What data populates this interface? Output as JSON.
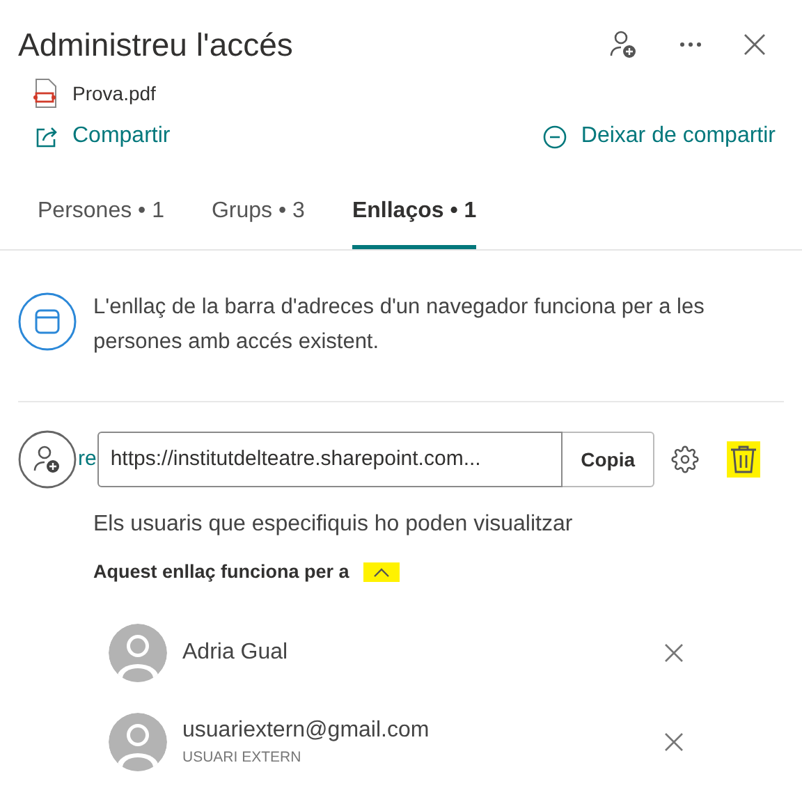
{
  "title": "Administreu l'accés",
  "file": {
    "name": "Prova.pdf"
  },
  "actions": {
    "share": "Compartir",
    "stop_sharing": "Deixar de compartir"
  },
  "tabs": [
    {
      "label": "Persones • 1",
      "selected": false
    },
    {
      "label": "Grups • 3",
      "selected": false
    },
    {
      "label": "Enllaços • 1",
      "selected": true
    }
  ],
  "info": "L'enllaç de la barra d'adreces d'un navegador funciona per a les persones amb accés existent.",
  "link": {
    "hidden_fragment": "re",
    "url": "https://institutdelteatre.sharepoint.com...",
    "copy": "Copia",
    "delete_highlighted": true
  },
  "permission": "Els usuaris que especifiquis ho poden visualitzar",
  "works_for": {
    "label": "Aquest enllaç funciona per a",
    "expanded": true,
    "highlighted": true
  },
  "people": [
    {
      "name": "Adria Gual"
    },
    {
      "name": "usuariextern@gmail.com",
      "subtitle": "USUARI EXTERN"
    }
  ]
}
